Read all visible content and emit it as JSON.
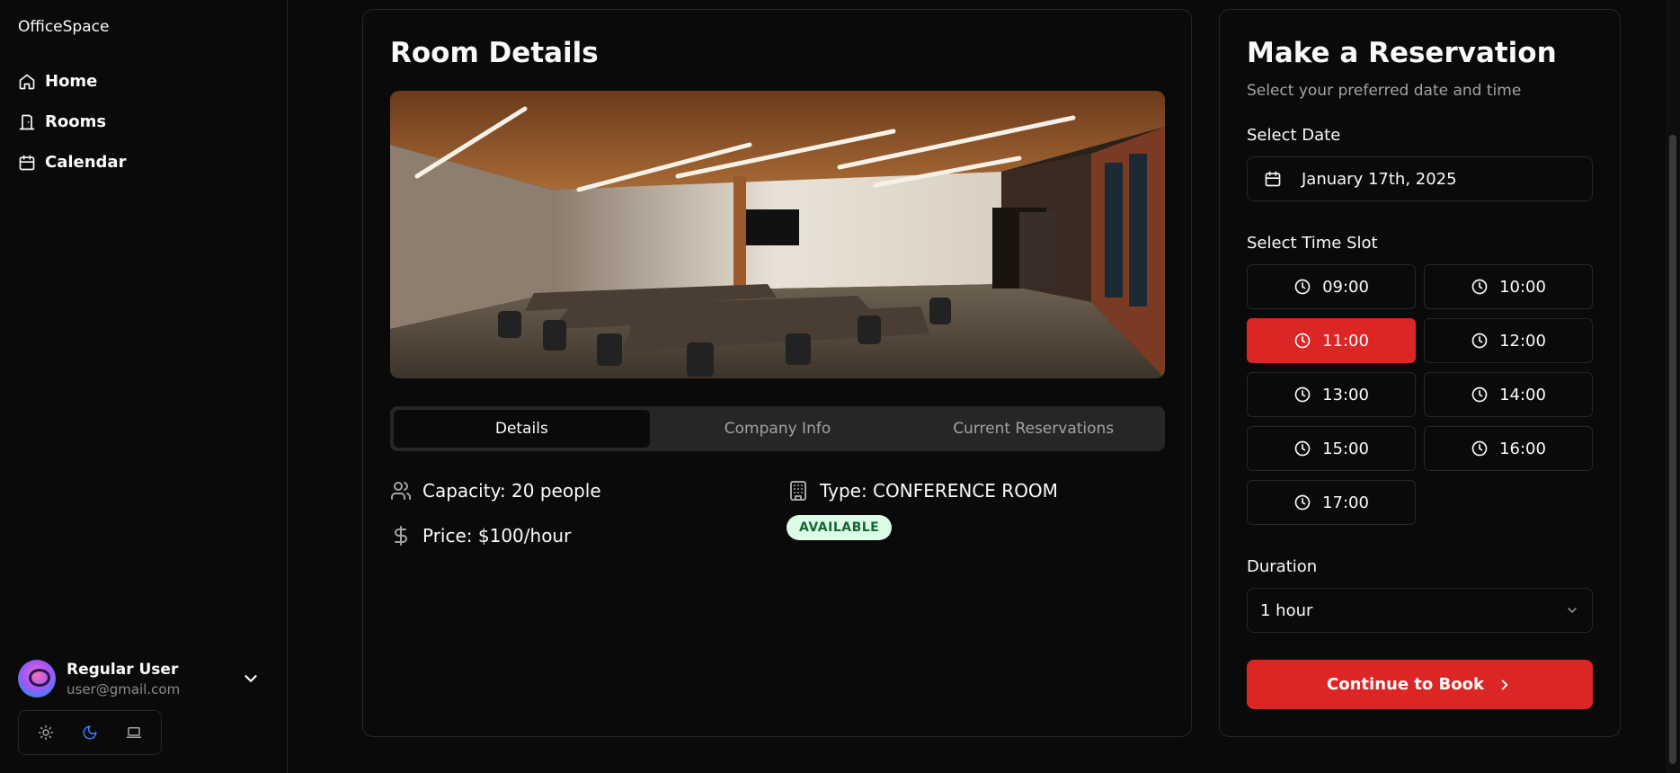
{
  "app": {
    "brand": "OfficeSpace"
  },
  "sidebar": {
    "items": [
      {
        "label": "Home",
        "icon": "home-icon"
      },
      {
        "label": "Rooms",
        "icon": "door-icon"
      },
      {
        "label": "Calendar",
        "icon": "calendar-icon"
      }
    ],
    "user": {
      "name": "Regular User",
      "email": "user@gmail.com"
    },
    "theme": {
      "options": [
        "light",
        "dark",
        "system"
      ],
      "selected": "dark"
    }
  },
  "room": {
    "title": "Room Details",
    "tabs": [
      {
        "label": "Details",
        "active": true
      },
      {
        "label": "Company Info",
        "active": false
      },
      {
        "label": "Current Reservations",
        "active": false
      }
    ],
    "capacity": "Capacity: 20 people",
    "type": "Type: CONFERENCE ROOM",
    "price": "Price: $100/hour",
    "status": "AVAILABLE"
  },
  "reservation": {
    "title": "Make a Reservation",
    "subtitle": "Select your preferred date and time",
    "date_label": "Select Date",
    "date_value": "January 17th, 2025",
    "time_label": "Select Time Slot",
    "slots": [
      "09:00",
      "10:00",
      "11:00",
      "12:00",
      "13:00",
      "14:00",
      "15:00",
      "16:00",
      "17:00"
    ],
    "selected_slot": "11:00",
    "duration_label": "Duration",
    "duration_value": "1 hour",
    "button_label": "Continue to Book"
  },
  "colors": {
    "accent": "#dc2626",
    "background": "#0a0a0a",
    "border": "#262626",
    "badge_bg": "#dcfce7",
    "badge_text": "#166534"
  }
}
